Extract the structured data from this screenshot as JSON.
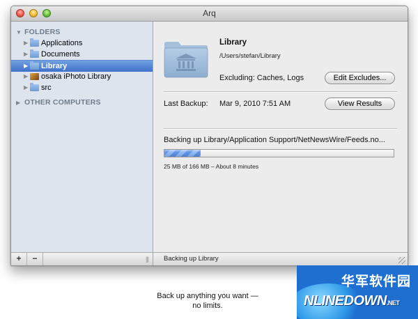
{
  "window": {
    "title": "Arq"
  },
  "sidebar": {
    "folders_header": "FOLDERS",
    "items": [
      {
        "label": "Applications",
        "selected": false
      },
      {
        "label": "Documents",
        "selected": false
      },
      {
        "label": "Library",
        "selected": true
      },
      {
        "label": "osaka iPhoto Library",
        "selected": false
      },
      {
        "label": "src",
        "selected": false
      }
    ],
    "other_header": "OTHER COMPUTERS",
    "add_label": "+",
    "remove_label": "−",
    "grip_label": "|||"
  },
  "detail": {
    "folder_name": "Library",
    "folder_path": "/Users/stefan/Library",
    "excluding": "Excluding: Caches, Logs",
    "edit_excludes_label": "Edit Excludes...",
    "last_backup_label": "Last Backup:",
    "last_backup_value": "Mar 9, 2010 7:51 AM",
    "view_results_label": "View Results",
    "backing_up_text": "Backing up Library/Application Support/NetNewsWire/Feeds.no...",
    "progress_fraction": 0.157,
    "progress_text": "25 MB of 166 MB – About 8 minutes"
  },
  "status_bar": {
    "text": "Backing up Library"
  },
  "caption": {
    "line1": "Back up anything you want —",
    "line2": "no limits."
  },
  "watermark": {
    "cn": "华军软件园",
    "en": "NLINEDOWN",
    "net": ".NET"
  },
  "colors": {
    "selection": "#3f71c9",
    "sidebar_bg": "#dde4ed",
    "progress": "#5d93e6"
  }
}
